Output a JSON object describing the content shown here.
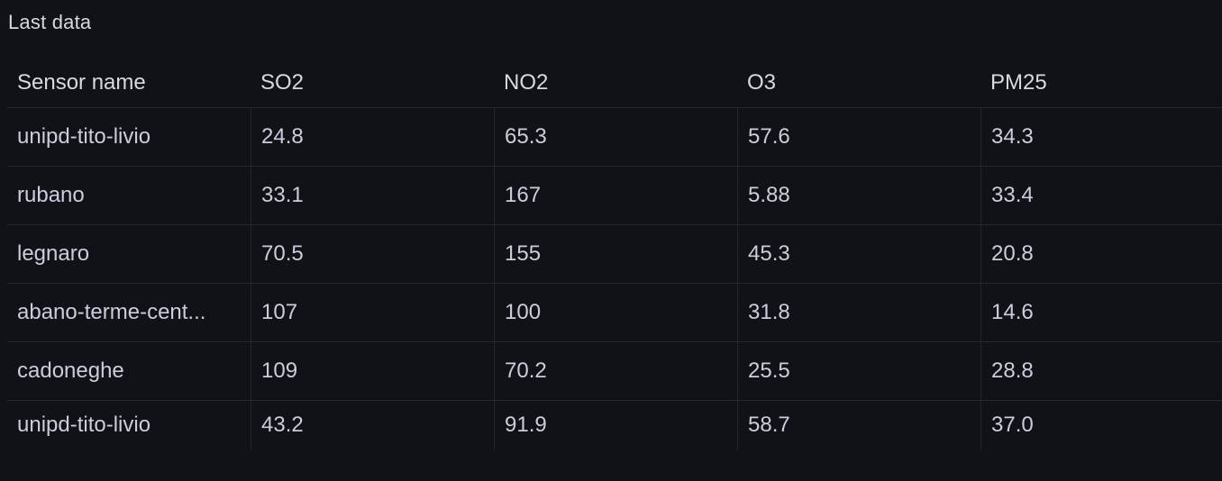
{
  "panel": {
    "title": "Last data"
  },
  "table": {
    "columns": [
      "Sensor name",
      "SO2",
      "NO2",
      "O3",
      "PM25"
    ],
    "rows": [
      [
        "unipd-tito-livio",
        "24.8",
        "65.3",
        "57.6",
        "34.3"
      ],
      [
        "rubano",
        "33.1",
        "167",
        "5.88",
        "33.4"
      ],
      [
        "legnaro",
        "70.5",
        "155",
        "45.3",
        "20.8"
      ],
      [
        "abano-terme-cent...",
        "107",
        "100",
        "31.8",
        "14.6"
      ],
      [
        "cadoneghe",
        "109",
        "70.2",
        "25.5",
        "28.8"
      ],
      [
        "unipd-tito-livio",
        "43.2",
        "91.9",
        "58.7",
        "37.0"
      ]
    ]
  },
  "colors": {
    "background": "#111217",
    "text": "#ccccdc",
    "border": "#24262c"
  }
}
